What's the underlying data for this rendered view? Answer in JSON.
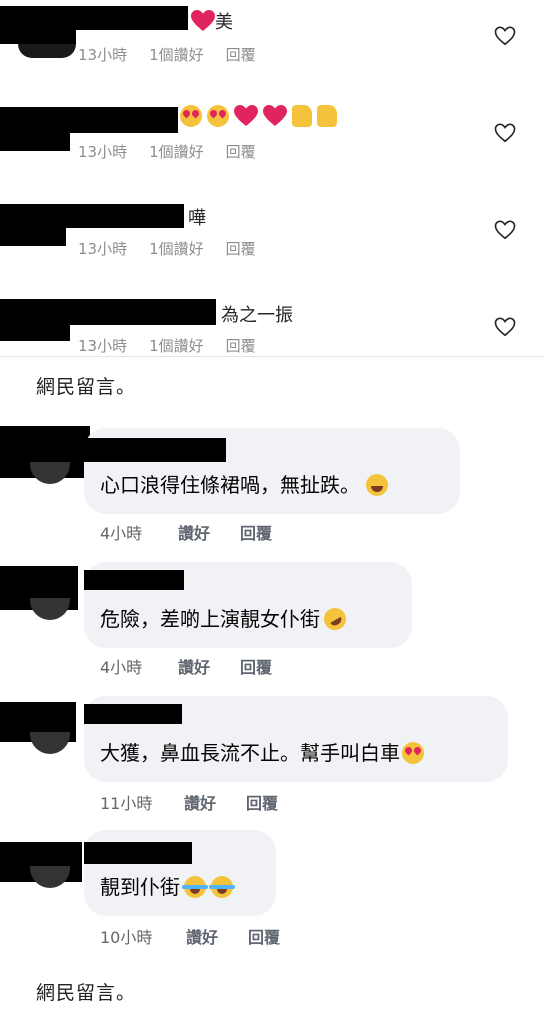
{
  "ig_comments": [
    {
      "text": "美",
      "emojis": [
        "red-heart"
      ],
      "time": "13小時",
      "likes": "1個讚好",
      "reply": "回覆"
    },
    {
      "text": "",
      "emojis": [
        "heart-eyes",
        "heart-eyes",
        "red-heart",
        "red-heart",
        "thumbs-up",
        "thumbs-up"
      ],
      "time": "13小時",
      "likes": "1個讚好",
      "reply": "回覆"
    },
    {
      "text": "嘩",
      "emojis": [],
      "time": "13小時",
      "likes": "1個讚好",
      "reply": "回覆"
    },
    {
      "text": "為之一振",
      "emojis": [],
      "time": "13小時",
      "likes": "1個讚好",
      "reply": "回覆"
    }
  ],
  "caption_top": "網民留言。",
  "fb_comments": [
    {
      "text": "心口浪得住條裙喎，無扯跌。",
      "emoji": "laughing-face",
      "time": "4小時",
      "like": "讚好",
      "reply": "回覆"
    },
    {
      "text": "危險，差啲上演靚女仆街",
      "emoji": "rofl-face",
      "time": "4小時",
      "like": "讚好",
      "reply": "回覆"
    },
    {
      "text": "大獲，鼻血長流不止。幫手叫白車",
      "emoji": "heart-eyes",
      "time": "11小時",
      "like": "讚好",
      "reply": "回覆"
    },
    {
      "text": "靚到仆街",
      "emoji": "joy-faces",
      "time": "10小時",
      "like": "讚好",
      "reply": "回覆"
    }
  ],
  "caption_bottom": "網民留言。",
  "colors": {
    "heart": "#e0245e",
    "bubble": "#f0f2f5",
    "meta": "#8e8e8e"
  }
}
